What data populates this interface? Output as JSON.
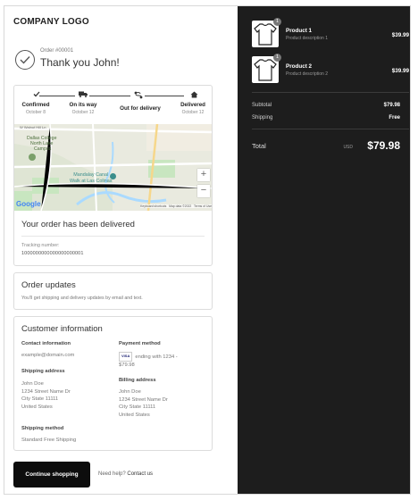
{
  "header": {
    "logo": "COMPANY LOGO"
  },
  "confirmation": {
    "order_number": "Order #00001",
    "thank_you": "Thank you John!"
  },
  "progress": {
    "steps": [
      {
        "label": "Confirmed",
        "date": "October 8",
        "icon": "check-icon"
      },
      {
        "label": "On its way",
        "date": "October 12",
        "icon": "truck-icon"
      },
      {
        "label": "Out for delivery",
        "date": "",
        "icon": "route-icon"
      },
      {
        "label": "Delivered",
        "date": "October 12",
        "icon": "home-icon"
      }
    ]
  },
  "map": {
    "labels": [
      "Dallas College",
      "North Lake",
      "Campus",
      "Mandalay Canal",
      "Walk at Las Colinas"
    ],
    "street_label": "W Walnut Hill Ln",
    "google": "Google",
    "attribution": [
      "Keyboard shortcuts",
      "Map data ©2022",
      "Terms of Use"
    ],
    "zoom_in": "+",
    "zoom_out": "−"
  },
  "delivery": {
    "title": "Your order has been delivered",
    "tracking_label": "Tracking number:",
    "tracking_number": "1000000000000000000001"
  },
  "updates": {
    "title": "Order updates",
    "subtitle": "You'll get shipping and delivery updates by email and text."
  },
  "customer": {
    "title": "Customer information",
    "contact_head": "Contact information",
    "contact_email": "example@domain.com",
    "payment_head": "Payment method",
    "payment_card": "VISA",
    "payment_text": "ending with 1234 -",
    "payment_amount": "$79.98",
    "shipping_head": "Shipping address",
    "shipping_lines": [
      "John Doe",
      "1234 Street Name Dr",
      "City State 11111",
      "United States"
    ],
    "billing_head": "Billing address",
    "billing_lines": [
      "John Doe",
      "1234 Street Name Dr",
      "City State 11111",
      "United States"
    ],
    "method_head": "Shipping method",
    "method_value": "Standard Free Shipping"
  },
  "footer": {
    "continue_label": "Continue shopping",
    "help_text": "Need help?",
    "contact_link": "Contact us"
  },
  "summary": {
    "products": [
      {
        "qty": "1",
        "name": "Product 1",
        "description": "Product description 1",
        "price": "$39.99"
      },
      {
        "qty": "1",
        "name": "Product 2",
        "description": "Product description 2",
        "price": "$39.99"
      }
    ],
    "subtotal_label": "Subtotal",
    "subtotal_value": "$79.98",
    "shipping_label": "Shipping",
    "shipping_value": "Free",
    "total_label": "Total",
    "currency": "USD",
    "total_value": "$79.98"
  },
  "colors": {
    "dark_panel": "#1d1d1d",
    "button": "#0d0d0d",
    "map_water": "#aadaff",
    "map_green": "#c8e6c0"
  }
}
